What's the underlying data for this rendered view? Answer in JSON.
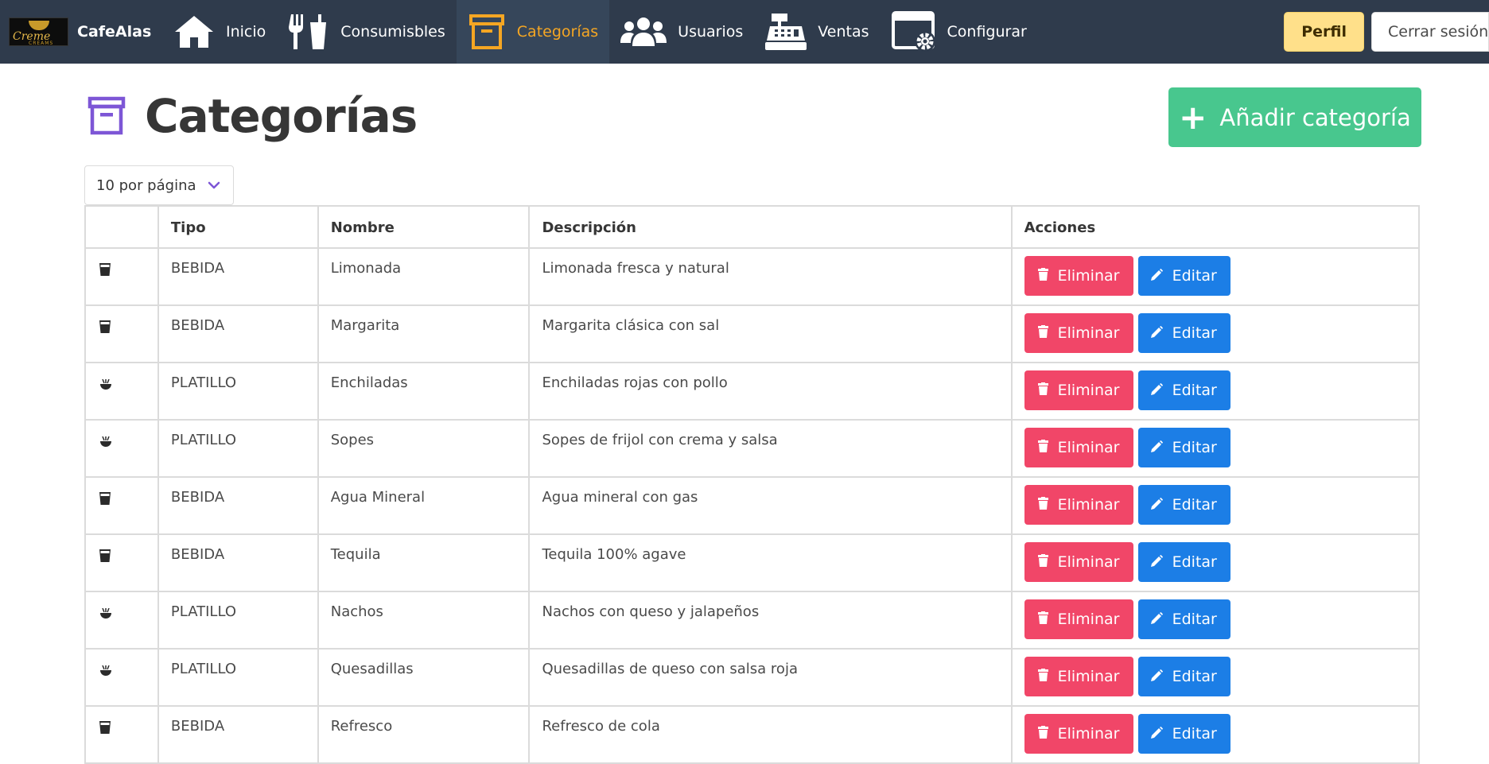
{
  "colors": {
    "navbar": "#2f3b4c",
    "nav_active_bg": "#36465a",
    "nav_active_text": "#f5a623",
    "perfil_btn": "#ffe08a",
    "add_btn": "#48c78e",
    "delete_btn": "#f14668",
    "edit_btn": "#1c7ee6",
    "title_icon": "#7d56d6"
  },
  "brand": {
    "logo_text": "Creme",
    "logo_subtext": "CREAMS",
    "name": "CafeAlas"
  },
  "nav": {
    "items": [
      {
        "label": "Inicio",
        "icon": "home-icon",
        "active": false
      },
      {
        "label": "Consumisbles",
        "icon": "utensils-drink-icon",
        "active": false
      },
      {
        "label": "Categorías",
        "icon": "archive-box-icon",
        "active": true
      },
      {
        "label": "Usuarios",
        "icon": "users-icon",
        "active": false
      },
      {
        "label": "Ventas",
        "icon": "cash-register-icon",
        "active": false
      },
      {
        "label": "Configurar",
        "icon": "window-gear-icon",
        "active": false
      }
    ],
    "perfil_label": "Perfil",
    "logout_label": "Cerrar sesión"
  },
  "page": {
    "title": "Categorías",
    "title_icon": "archive-box-icon",
    "add_label": "Añadir categoría",
    "per_page": "10 por página"
  },
  "table": {
    "headers": [
      "",
      "Tipo",
      "Nombre",
      "Descripción",
      "Acciones"
    ],
    "delete_label": "Eliminar",
    "edit_label": "Editar",
    "rows": [
      {
        "icon": "glass-icon",
        "tipo": "BEBIDA",
        "nombre": "Limonada",
        "descripcion": "Limonada fresca y natural"
      },
      {
        "icon": "glass-icon",
        "tipo": "BEBIDA",
        "nombre": "Margarita",
        "descripcion": "Margarita clásica con sal"
      },
      {
        "icon": "bowl-icon",
        "tipo": "PLATILLO",
        "nombre": "Enchiladas",
        "descripcion": "Enchiladas rojas con pollo"
      },
      {
        "icon": "bowl-icon",
        "tipo": "PLATILLO",
        "nombre": "Sopes",
        "descripcion": "Sopes de frijol con crema y salsa"
      },
      {
        "icon": "glass-icon",
        "tipo": "BEBIDA",
        "nombre": "Agua Mineral",
        "descripcion": "Agua mineral con gas"
      },
      {
        "icon": "glass-icon",
        "tipo": "BEBIDA",
        "nombre": "Tequila",
        "descripcion": "Tequila 100% agave"
      },
      {
        "icon": "bowl-icon",
        "tipo": "PLATILLO",
        "nombre": "Nachos",
        "descripcion": "Nachos con queso y jalapeños"
      },
      {
        "icon": "bowl-icon",
        "tipo": "PLATILLO",
        "nombre": "Quesadillas",
        "descripcion": "Quesadillas de queso con salsa roja"
      },
      {
        "icon": "glass-icon",
        "tipo": "BEBIDA",
        "nombre": "Refresco",
        "descripcion": "Refresco de cola"
      }
    ]
  }
}
